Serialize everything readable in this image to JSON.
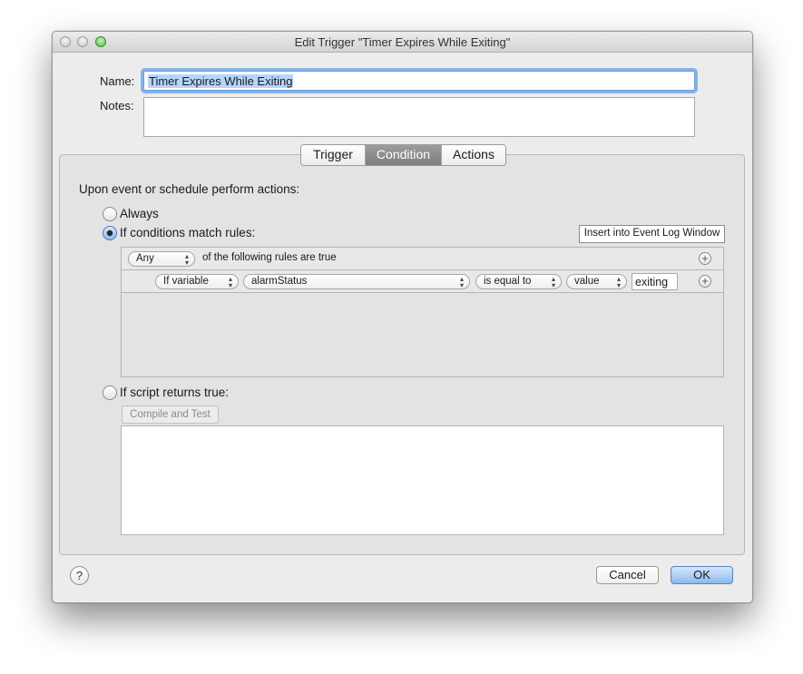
{
  "window": {
    "title": "Edit Trigger \"Timer Expires While Exiting\""
  },
  "form": {
    "name_label": "Name:",
    "name_value": "Timer Expires While Exiting",
    "notes_label": "Notes:",
    "notes_value": ""
  },
  "tabs": [
    {
      "label": "Trigger",
      "selected": false
    },
    {
      "label": "Condition",
      "selected": true
    },
    {
      "label": "Actions",
      "selected": false
    }
  ],
  "condition": {
    "heading": "Upon event or schedule perform actions:",
    "option_always": "Always",
    "option_rules": "If conditions match rules:",
    "option_script": "If script returns true:",
    "selected_option": "If conditions match rules:",
    "insert_button": "Insert into Event Log Window",
    "match_mode": "Any",
    "match_suffix": "of the following rules are true",
    "rule": {
      "source": "If variable",
      "variable": "alarmStatus",
      "operator": "is equal to",
      "value_type": "value",
      "value": "exiting"
    },
    "compile_button": "Compile and Test",
    "script_text": ""
  },
  "footer": {
    "help_label": "?",
    "cancel": "Cancel",
    "ok": "OK"
  },
  "colors": {
    "window_bg": "#ececec",
    "focus_ring": "#85b3e8",
    "default_button": "#8db9ee"
  }
}
